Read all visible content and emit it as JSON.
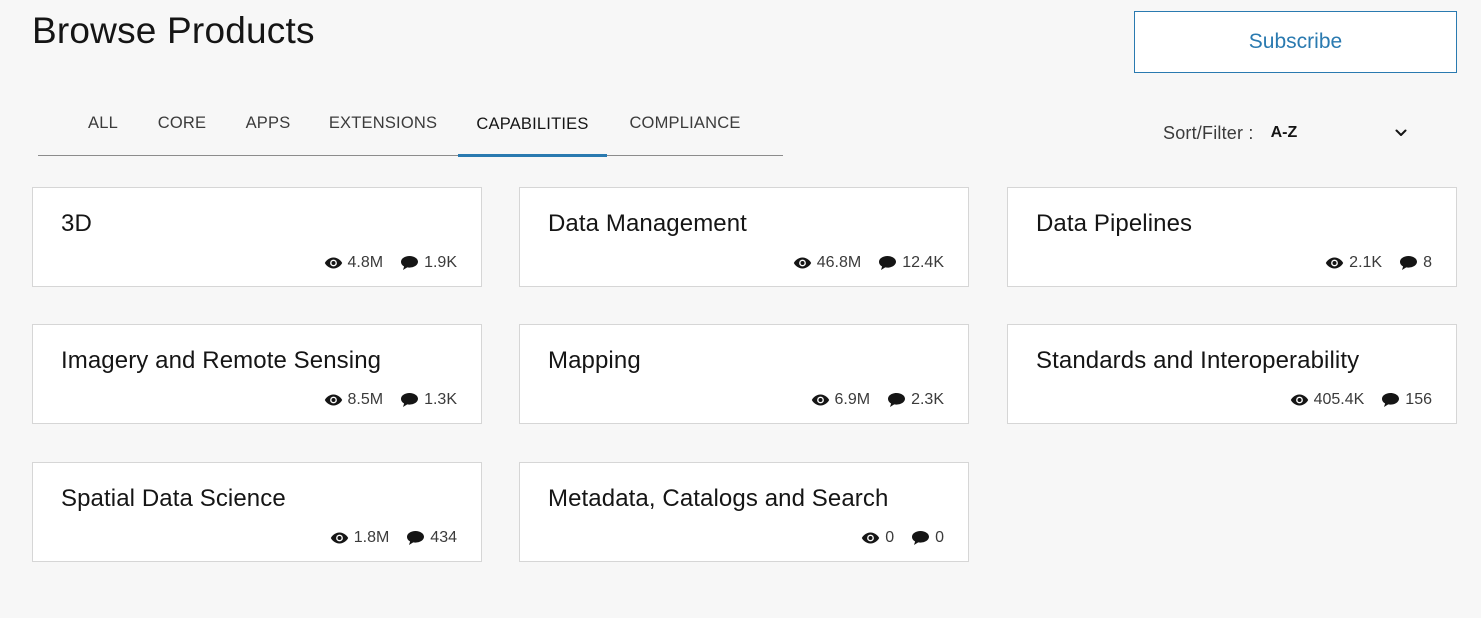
{
  "header": {
    "title": "Browse Products",
    "subscribe_label": "Subscribe"
  },
  "tabs": [
    {
      "label": "ALL",
      "active": false
    },
    {
      "label": "CORE",
      "active": false
    },
    {
      "label": "APPS",
      "active": false
    },
    {
      "label": "EXTENSIONS",
      "active": false
    },
    {
      "label": "CAPABILITIES",
      "active": true
    },
    {
      "label": "COMPLIANCE",
      "active": false
    }
  ],
  "sort_filter": {
    "label": "Sort/Filter :",
    "value": "A-Z"
  },
  "cards": [
    {
      "title": "3D",
      "views": "4.8M",
      "replies": "1.9K"
    },
    {
      "title": "Data Management",
      "views": "46.8M",
      "replies": "12.4K"
    },
    {
      "title": "Data Pipelines",
      "views": "2.1K",
      "replies": "8"
    },
    {
      "title": "Imagery and Remote Sensing",
      "views": "8.5M",
      "replies": "1.3K"
    },
    {
      "title": "Mapping",
      "views": "6.9M",
      "replies": "2.3K"
    },
    {
      "title": "Standards and Interoperability",
      "views": "405.4K",
      "replies": "156"
    },
    {
      "title": "Spatial Data Science",
      "views": "1.8M",
      "replies": "434"
    },
    {
      "title": "Metadata, Catalogs and Search",
      "views": "0",
      "replies": "0"
    }
  ],
  "colors": {
    "accent": "#2a7ab0",
    "background": "#f7f7f7",
    "card": "#ffffff",
    "text": "#151515"
  },
  "icons": {
    "views": "eye-icon",
    "replies": "speech-bubble-icon",
    "sort": "chevron-down-icon"
  }
}
